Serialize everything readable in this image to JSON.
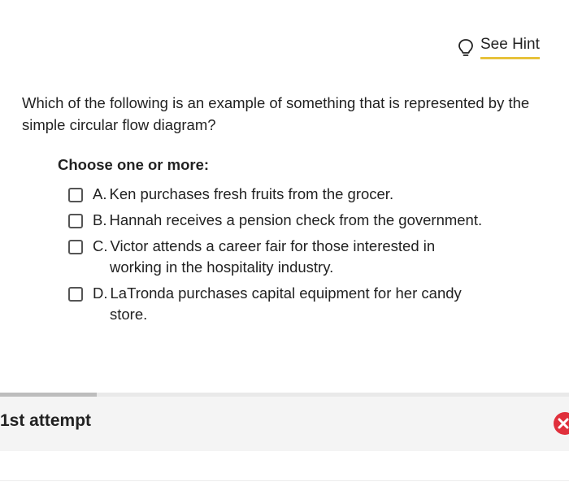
{
  "hint": {
    "label": "See Hint",
    "icon": "lightbulb-icon",
    "underline_color": "#e7c23b"
  },
  "question": {
    "text": "Which of the following is an example of something that is represented by the simple circular flow diagram?"
  },
  "instruction": "Choose one or more:",
  "options": [
    {
      "letter": "A.",
      "text": "Ken purchases fresh fruits from the grocer.",
      "checked": false
    },
    {
      "letter": "B.",
      "text": "Hannah receives a pension check from the government.",
      "checked": false
    },
    {
      "letter": "C.",
      "line1": "Victor attends a career fair for those interested in",
      "line2": "working in the hospitality industry.",
      "checked": false
    },
    {
      "letter": "D.",
      "line1": "LaTronda purchases capital equipment for her candy",
      "line2": "store.",
      "checked": false
    }
  ],
  "attempt": {
    "label": "1st attempt",
    "progress_fraction": 0.17,
    "status_icon": "incorrect-x-icon",
    "status_color": "#e0303c"
  }
}
